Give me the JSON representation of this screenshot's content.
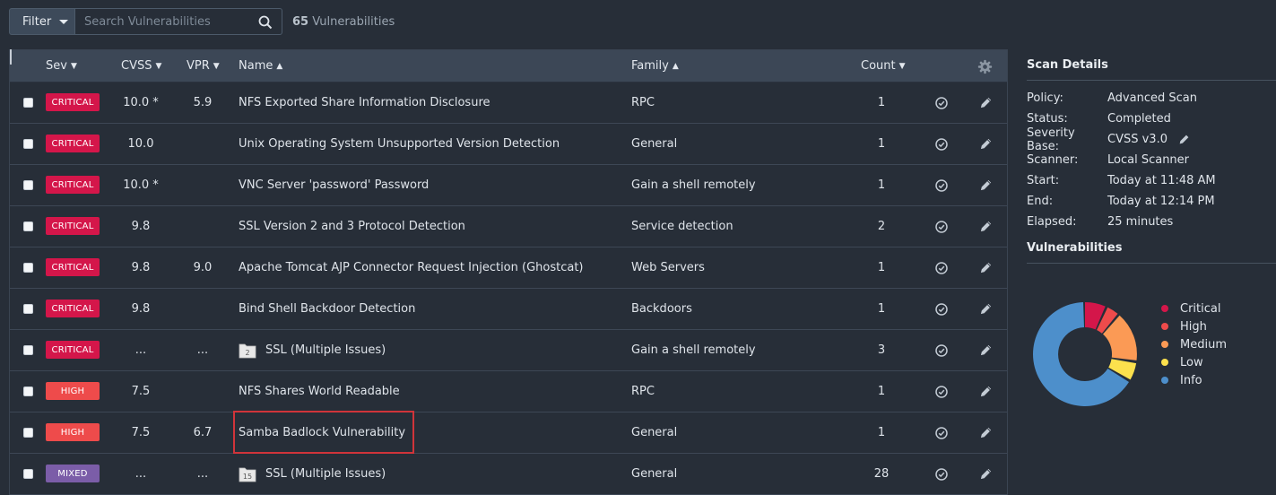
{
  "toolbar": {
    "filter_label": "Filter",
    "search_placeholder": "Search Vulnerabilities",
    "count_number": "65",
    "count_label": "Vulnerabilities"
  },
  "table": {
    "headers": {
      "sev": "Sev",
      "cvss": "CVSS",
      "vpr": "VPR",
      "name": "Name",
      "family": "Family",
      "count": "Count"
    },
    "rows": [
      {
        "sev": "CRITICAL",
        "cvss": "10.0 *",
        "vpr": "5.9",
        "name": "NFS Exported Share Information Disclosure",
        "family": "RPC",
        "count": "1"
      },
      {
        "sev": "CRITICAL",
        "cvss": "10.0",
        "vpr": "",
        "name": "Unix Operating System Unsupported Version Detection",
        "family": "General",
        "count": "1"
      },
      {
        "sev": "CRITICAL",
        "cvss": "10.0 *",
        "vpr": "",
        "name": "VNC Server 'password' Password",
        "family": "Gain a shell remotely",
        "count": "1"
      },
      {
        "sev": "CRITICAL",
        "cvss": "9.8",
        "vpr": "",
        "name": "SSL Version 2 and 3 Protocol Detection",
        "family": "Service detection",
        "count": "2"
      },
      {
        "sev": "CRITICAL",
        "cvss": "9.8",
        "vpr": "9.0",
        "name": "Apache Tomcat AJP Connector Request Injection (Ghostcat)",
        "family": "Web Servers",
        "count": "1"
      },
      {
        "sev": "CRITICAL",
        "cvss": "9.8",
        "vpr": "",
        "name": "Bind Shell Backdoor Detection",
        "family": "Backdoors",
        "count": "1"
      },
      {
        "sev": "CRITICAL",
        "cvss": "...",
        "vpr": "...",
        "name": "SSL (Multiple Issues)",
        "family": "Gain a shell remotely",
        "count": "3",
        "group_count": "2"
      },
      {
        "sev": "HIGH",
        "cvss": "7.5",
        "vpr": "",
        "name": "NFS Shares World Readable",
        "family": "RPC",
        "count": "1"
      },
      {
        "sev": "HIGH",
        "cvss": "7.5",
        "vpr": "6.7",
        "name": "Samba Badlock Vulnerability",
        "family": "General",
        "count": "1",
        "highlighted": true
      },
      {
        "sev": "MIXED",
        "cvss": "...",
        "vpr": "...",
        "name": "SSL (Multiple Issues)",
        "family": "General",
        "count": "28",
        "group_count": "15"
      }
    ]
  },
  "severity_colors": {
    "CRITICAL": "#d4164a",
    "HIGH": "#ee4b4b",
    "MIXED": "#7b5da8"
  },
  "scan_details": {
    "title": "Scan Details",
    "items": [
      {
        "key": "Policy:",
        "value": "Advanced Scan"
      },
      {
        "key": "Status:",
        "value": "Completed"
      },
      {
        "key": "Severity Base:",
        "value": "CVSS v3.0"
      },
      {
        "key": "Scanner:",
        "value": "Local Scanner"
      },
      {
        "key": "Start:",
        "value": "Today at 11:48 AM"
      },
      {
        "key": "End:",
        "value": "Today at 12:14 PM"
      },
      {
        "key": "Elapsed:",
        "value": "25 minutes"
      }
    ]
  },
  "vulnerabilities": {
    "title": "Vulnerabilities",
    "legend": [
      {
        "label": "Critical",
        "color": "#d4164a"
      },
      {
        "label": "High",
        "color": "#ee4b4b"
      },
      {
        "label": "Medium",
        "color": "#fb9a55"
      },
      {
        "label": "Low",
        "color": "#fce14d"
      },
      {
        "label": "Info",
        "color": "#4d8fcb"
      }
    ]
  }
}
